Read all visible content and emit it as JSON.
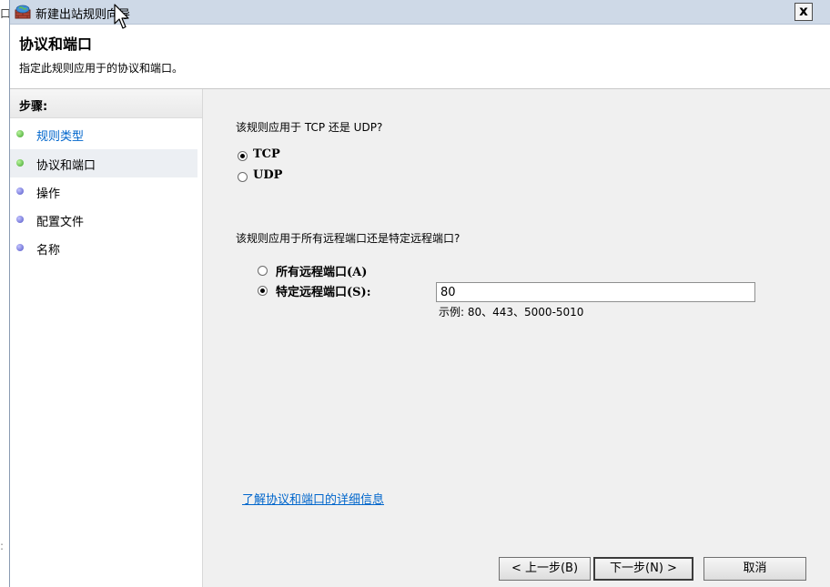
{
  "outer": {
    "frag1": "口",
    "frag2": ":"
  },
  "window": {
    "title": "新建出站规则向导",
    "close_label": "x"
  },
  "header": {
    "title": "协议和端口",
    "subtitle": "指定此规则应用于的协议和端口。"
  },
  "steps": {
    "header": "步骤:",
    "items": [
      {
        "label": "规则类型",
        "state": "completed-link"
      },
      {
        "label": "协议和端口",
        "state": "current"
      },
      {
        "label": "操作",
        "state": "pending"
      },
      {
        "label": "配置文件",
        "state": "pending"
      },
      {
        "label": "名称",
        "state": "pending"
      }
    ]
  },
  "protocol": {
    "question": "该规则应用于 TCP 还是 UDP?",
    "options": [
      {
        "label": "TCP",
        "checked": true
      },
      {
        "label": "UDP",
        "checked": false
      }
    ]
  },
  "ports": {
    "question": "该规则应用于所有远程端口还是特定远程端口?",
    "options": [
      {
        "label": "所有远程端口(A)",
        "checked": false
      },
      {
        "label": "特定远程端口(S):",
        "checked": true
      }
    ],
    "value": "80",
    "example": "示例: 80、443、5000-5010"
  },
  "link": "了解协议和端口的详细信息",
  "buttons": {
    "back": "< 上一步(B)",
    "next": "下一步(N) >",
    "cancel": "取消"
  }
}
